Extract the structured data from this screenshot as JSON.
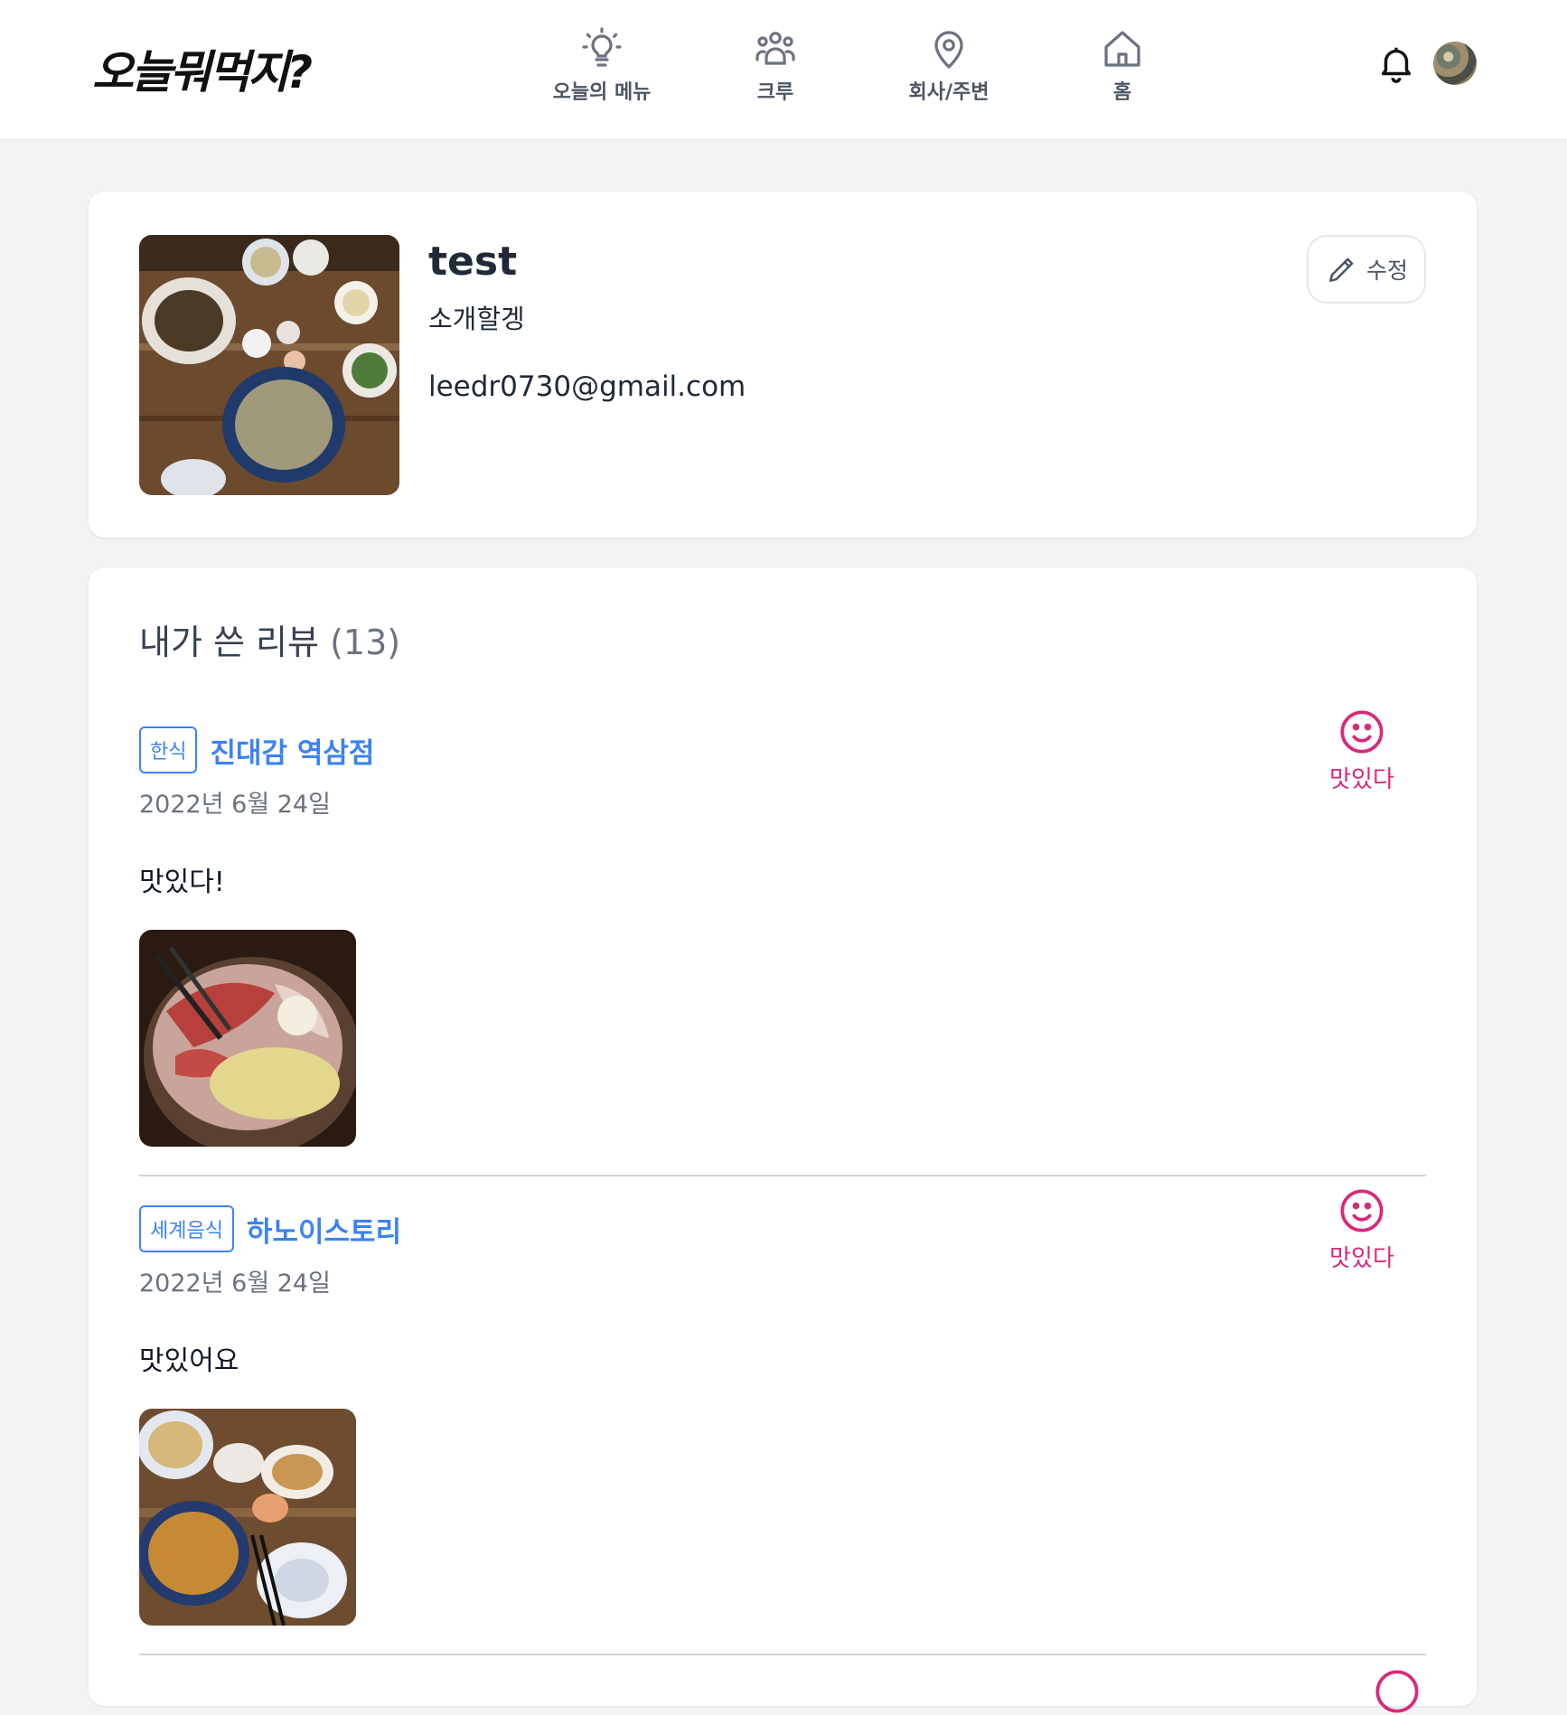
{
  "app": {
    "logo": "오늘뭐먹지?"
  },
  "nav": [
    {
      "label": "오늘의 메뉴",
      "icon": "lightbulb-icon"
    },
    {
      "label": "크루",
      "icon": "group-icon"
    },
    {
      "label": "회사/주변",
      "icon": "location-pin-icon"
    },
    {
      "label": "홈",
      "icon": "home-icon"
    }
  ],
  "header": {
    "bell_icon": "bell-icon",
    "avatar_icon": "avatar"
  },
  "profile": {
    "name": "test",
    "intro": "소개할겡",
    "email": "leedr0730@gmail.com",
    "edit_label": "수정"
  },
  "reviews": {
    "title": "내가 쓴 리뷰",
    "count": "(13)",
    "items": [
      {
        "category": "한식",
        "restaurant": "진대감 역삼점",
        "date": "2022년 6월 24일",
        "text": "맛있다!",
        "rating_label": "맛있다",
        "rating_icon": "smile-icon"
      },
      {
        "category": "세계음식",
        "restaurant": "하노이스토리",
        "date": "2022년 6월 24일",
        "text": "맛있어요",
        "rating_label": "맛있다",
        "rating_icon": "smile-icon"
      }
    ]
  },
  "colors": {
    "accent": "#3b82f6",
    "rating": "#db2777"
  }
}
